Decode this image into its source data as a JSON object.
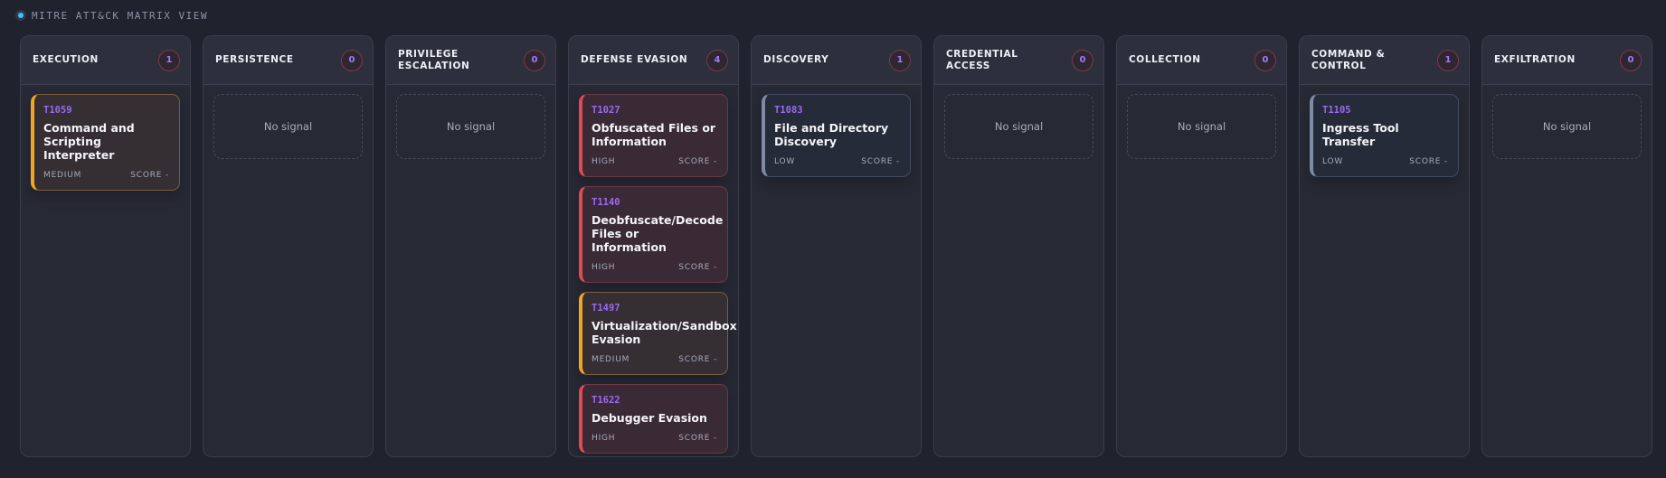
{
  "header": {
    "title": "MITRE ATT&CK MATRIX VIEW"
  },
  "empty_label": "No signal",
  "score_label": "SCORE -",
  "columns": [
    {
      "title": "EXECUTION",
      "count": "1",
      "cards": [
        {
          "id": "T1059",
          "name": "Command and Scripting Interpreter",
          "severity": "MEDIUM"
        }
      ]
    },
    {
      "title": "PERSISTENCE",
      "count": "0",
      "cards": []
    },
    {
      "title": "PRIVILEGE ESCALATION",
      "count": "0",
      "cards": []
    },
    {
      "title": "DEFENSE EVASION",
      "count": "4",
      "cards": [
        {
          "id": "T1027",
          "name": "Obfuscated Files or Information",
          "severity": "HIGH"
        },
        {
          "id": "T1140",
          "name": "Deobfuscate/Decode Files or Information",
          "severity": "HIGH"
        },
        {
          "id": "T1497",
          "name": "Virtualization/Sandbox Evasion",
          "severity": "MEDIUM"
        },
        {
          "id": "T1622",
          "name": "Debugger Evasion",
          "severity": "HIGH"
        }
      ]
    },
    {
      "title": "DISCOVERY",
      "count": "1",
      "cards": [
        {
          "id": "T1083",
          "name": "File and Directory Discovery",
          "severity": "LOW"
        }
      ]
    },
    {
      "title": "CREDENTIAL ACCESS",
      "count": "0",
      "cards": []
    },
    {
      "title": "COLLECTION",
      "count": "0",
      "cards": []
    },
    {
      "title": "COMMAND & CONTROL",
      "count": "1",
      "cards": [
        {
          "id": "T1105",
          "name": "Ingress Tool Transfer",
          "severity": "LOW"
        }
      ]
    },
    {
      "title": "EXFILTRATION",
      "count": "0",
      "cards": []
    }
  ],
  "colors": {
    "high": "#e04a52",
    "medium": "#f2a424",
    "low": "#7f8aa3",
    "technique_id": "#9b6af2",
    "status_dot": "#3ec1f3"
  }
}
